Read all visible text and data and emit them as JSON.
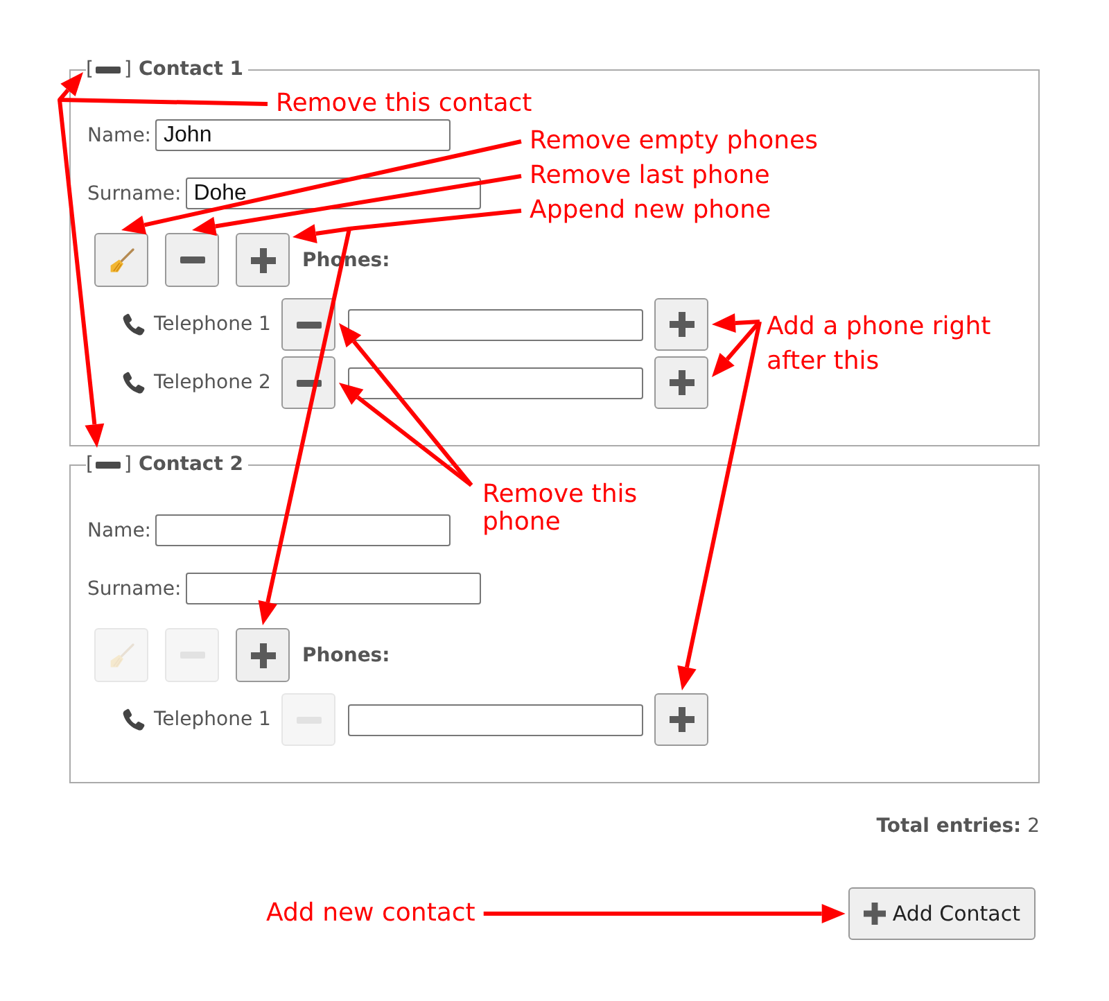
{
  "contacts": [
    {
      "remove_button": {
        "open": "[",
        "close": "]"
      },
      "title": "Contact 1",
      "fields": [
        {
          "label": "Name:",
          "value": "John"
        },
        {
          "label": "Surname:",
          "value": "Dohe"
        }
      ],
      "tools": [
        {
          "kind": "clean",
          "disabled": false
        },
        {
          "kind": "remove_last",
          "disabled": false
        },
        {
          "kind": "append",
          "disabled": false
        }
      ],
      "phones_label": "Phones:",
      "phones": [
        {
          "label": "Telephone 1",
          "remove_disabled": false
        },
        {
          "label": "Telephone 2",
          "remove_disabled": false
        }
      ]
    },
    {
      "remove_button": {
        "open": "[",
        "close": "]"
      },
      "title": "Contact 2",
      "fields": [
        {
          "label": "Name:"
        },
        {
          "label": "Surname:"
        }
      ],
      "tools": [
        {
          "kind": "clean",
          "disabled": true
        },
        {
          "kind": "remove_last",
          "disabled": true
        },
        {
          "kind": "append",
          "disabled": false
        }
      ],
      "phones_label": "Phones:",
      "phones": [
        {
          "label": "Telephone 1",
          "remove_disabled": true
        }
      ]
    }
  ],
  "total": {
    "text": "**Total entries:** 2"
  },
  "add_button": {
    "label": "Add Contact"
  },
  "annotations": [
    {
      "text": "Remove this contact"
    },
    {
      "text": "Remove empty phones"
    },
    {
      "text": "Remove last phone"
    },
    {
      "text": "Append new phone"
    },
    {
      "text": "Add a phone right after this"
    },
    {
      "text": "Remove this phone"
    },
    {
      "text": "Add new contact"
    }
  ]
}
